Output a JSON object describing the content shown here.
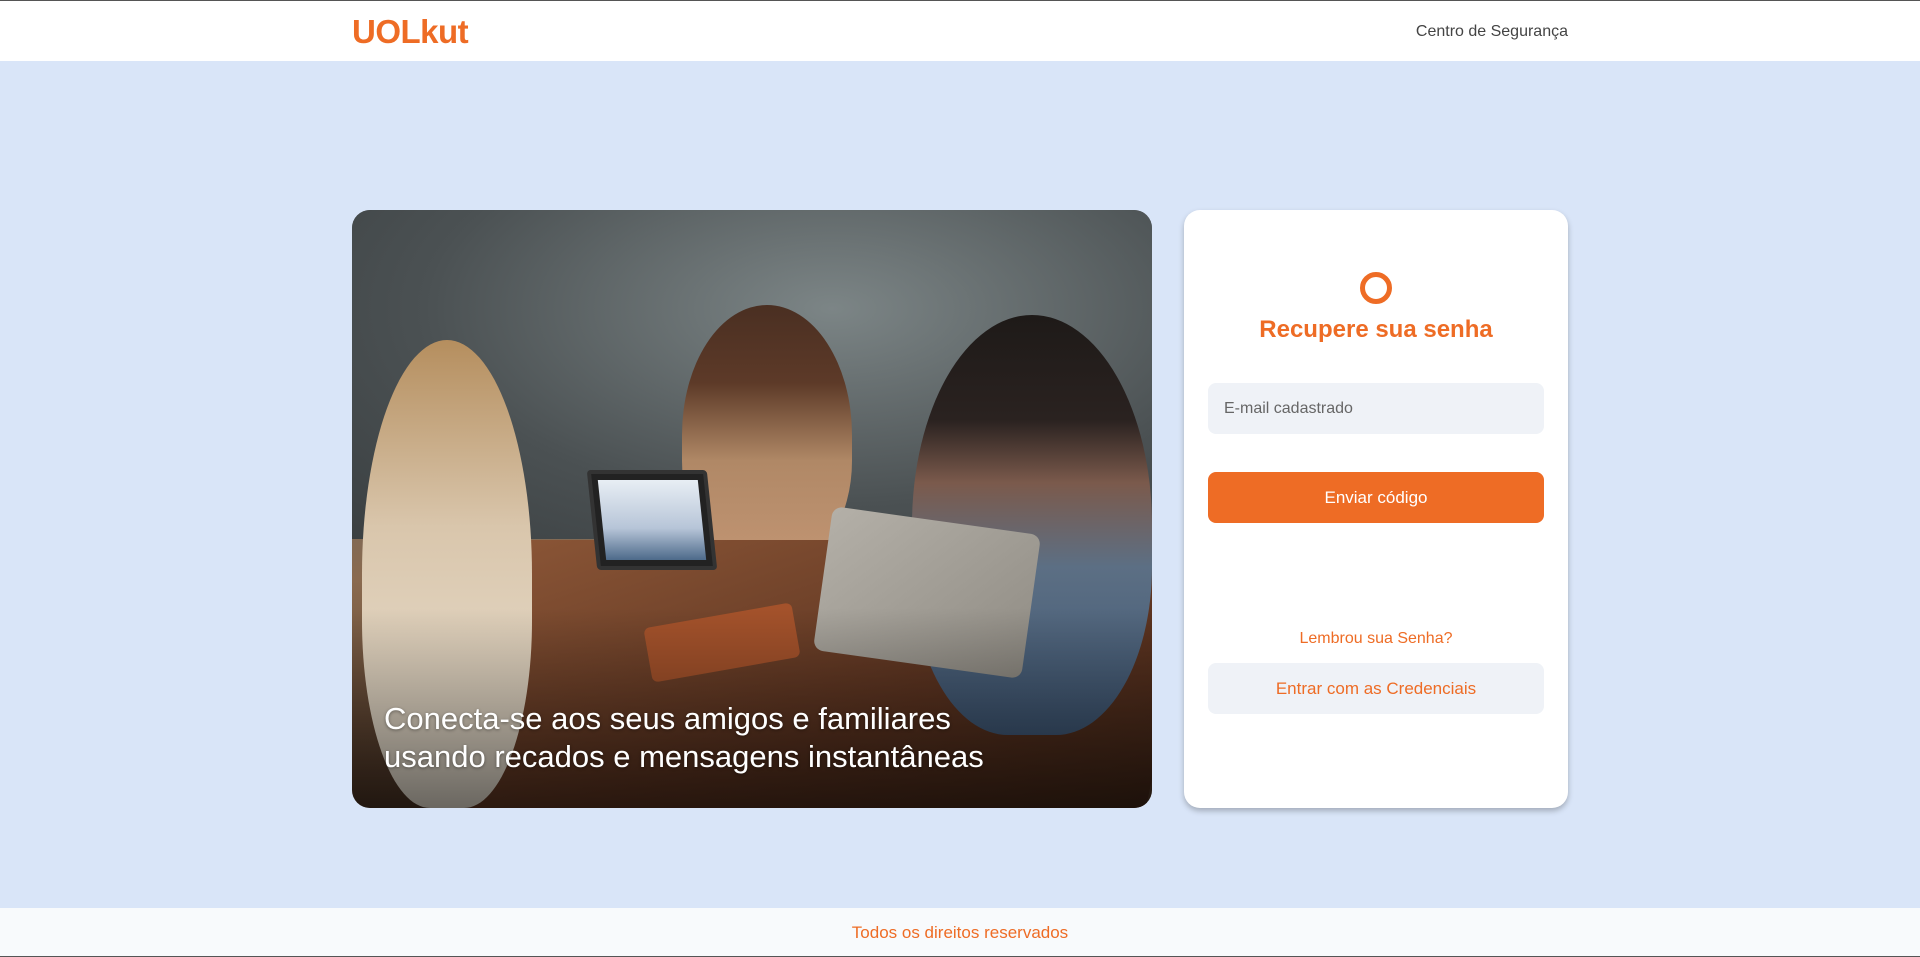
{
  "header": {
    "logo": "UOLkut",
    "nav_link": "Centro de Segurança"
  },
  "hero": {
    "caption": "Conecta-se aos seus amigos e familiares usando recados e mensagens instantâneas"
  },
  "recovery": {
    "icon": "ring-icon",
    "title": "Recupere sua senha",
    "email_placeholder": "E-mail cadastrado",
    "email_value": "",
    "send_label": "Enviar código",
    "remember_text": "Lembrou sua Senha?",
    "credentials_label": "Entrar com as Credenciais"
  },
  "footer": {
    "text": "Todos os direitos reservados"
  },
  "colors": {
    "accent": "#ee6c25",
    "background": "#d9e5f8",
    "input_bg": "#eff2f7"
  }
}
